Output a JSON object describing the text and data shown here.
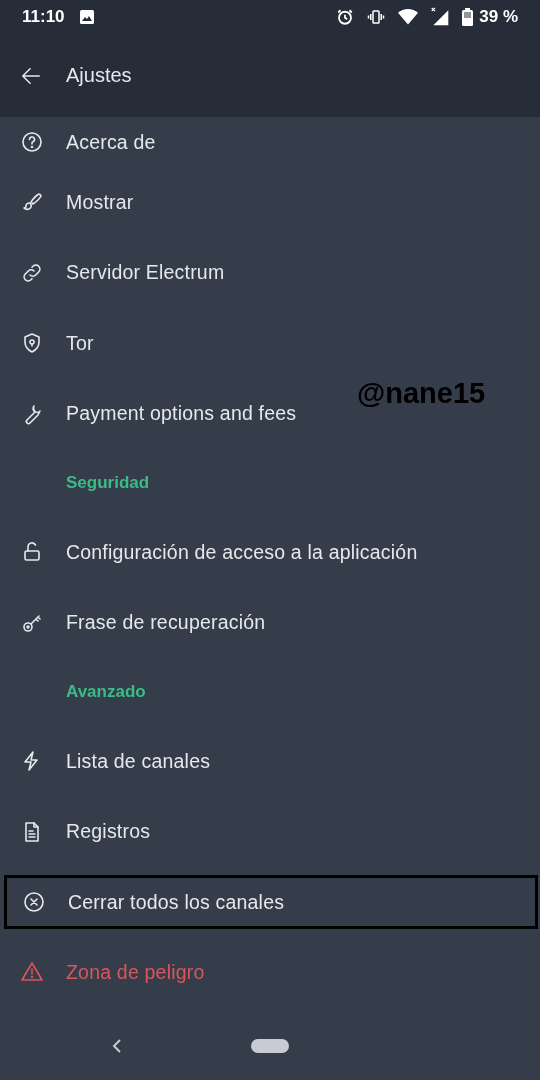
{
  "status_bar": {
    "time": "11:10",
    "battery": "39 %"
  },
  "app_bar": {
    "title": "Ajustes"
  },
  "items": [
    {
      "kind": "item",
      "label": "Acerca de",
      "highlighted": false
    },
    {
      "kind": "item",
      "label": "Mostrar",
      "highlighted": false
    },
    {
      "kind": "item",
      "label": "Servidor Electrum",
      "highlighted": false
    },
    {
      "kind": "item",
      "label": "Tor",
      "highlighted": false
    },
    {
      "kind": "item",
      "label": "Payment options and fees",
      "highlighted": false
    },
    {
      "kind": "header",
      "label": "Seguridad"
    },
    {
      "kind": "item",
      "label": "Configuración de acceso a la aplicación",
      "highlighted": false
    },
    {
      "kind": "item",
      "label": "Frase de recuperación",
      "highlighted": false
    },
    {
      "kind": "header",
      "label": "Avanzado"
    },
    {
      "kind": "item",
      "label": "Lista de canales",
      "highlighted": false
    },
    {
      "kind": "item",
      "label": "Registros",
      "highlighted": false
    },
    {
      "kind": "item",
      "label": "Cerrar todos los canales",
      "highlighted": true
    },
    {
      "kind": "danger",
      "label": "Zona de peligro",
      "highlighted": false
    }
  ],
  "overlay_text": "@nane15"
}
